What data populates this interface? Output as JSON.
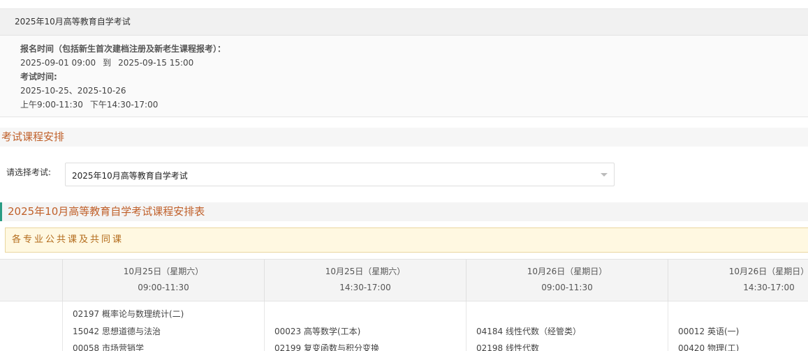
{
  "exam_info": {
    "title": "2025年10月高等教育自学考试",
    "registration_label": "报名时间（包括新生首次建档注册及新老生课程报考）：",
    "registration_start": "2025-09-01 09:00",
    "registration_to": "到",
    "registration_end": "2025-09-15 15:00",
    "exam_time_label": "考试时间:",
    "exam_dates": "2025-10-25、2025-10-26",
    "morning": "上午9:00-11:30",
    "afternoon": "下午14:30-17:00"
  },
  "section_title": "考试课程安排",
  "select": {
    "label": "请选择考试:",
    "value": "2025年10月高等教育自学考试"
  },
  "table_title": "2025年10月高等教育自学考试课程安排表",
  "notice": "各专业公共课及共同课",
  "schedule": {
    "columns": [
      {
        "date": "10月25日（星期六）",
        "time": "09:00-11:30"
      },
      {
        "date": "10月25日（星期六）",
        "time": "14:30-17:00"
      },
      {
        "date": "10月26日（星期日）",
        "time": "09:00-11:30"
      },
      {
        "date": "10月26日（星期日）",
        "time": "14:30-17:00"
      }
    ],
    "courses": [
      [
        "02197 概率论与数理统计(二)",
        "15042 思想道德与法治",
        "00058 市场营销学"
      ],
      [
        "00023 高等数学(工本)",
        "02199 复变函数与积分变换"
      ],
      [
        "04184 线性代数（经管类）",
        "02198 线性代数"
      ],
      [
        "00012 英语(一)",
        "00420 物理(工)"
      ]
    ]
  }
}
